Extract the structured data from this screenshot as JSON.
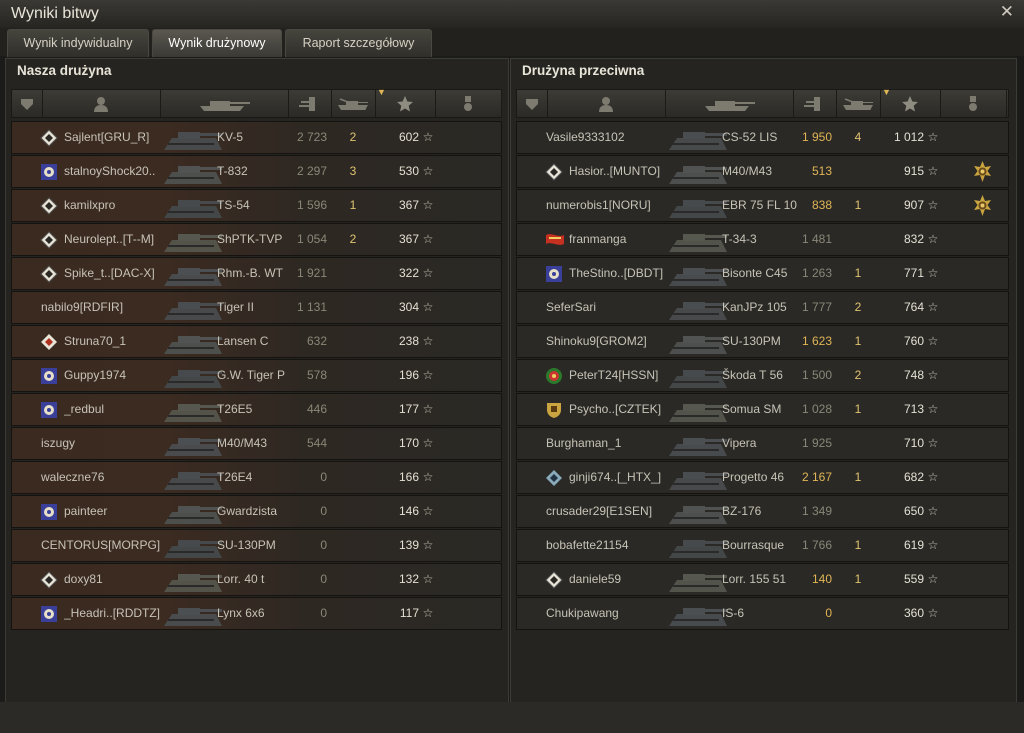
{
  "window": {
    "title": "Wyniki bitwy",
    "close_icon": "close-icon"
  },
  "tabs": [
    {
      "label": "Wynik indywidualny",
      "active": false
    },
    {
      "label": "Wynik drużynowy",
      "active": true
    },
    {
      "label": "Raport szczegółowy",
      "active": false
    }
  ],
  "colors": {
    "alive_row": "#3c2b21",
    "damage_highlight": "#e0b556",
    "kills": "#e0c370"
  },
  "our_team": {
    "title": "Nasza drużyna",
    "columns": [
      "squad-icon",
      "player-icon",
      "tank-icon",
      "damage-icon",
      "kills-icon",
      "xp-star-icon",
      "medal-icon"
    ],
    "players": [
      {
        "name": "Sajlent[GRU_R]",
        "vehicle": "KV-5",
        "damage": "2 723",
        "kills": "2",
        "xp": "602",
        "alive": true,
        "clan_icon": "diamond",
        "highlight_damage": false
      },
      {
        "name": "stalnoyShock20..",
        "vehicle": "T-832",
        "damage": "2 297",
        "kills": "3",
        "xp": "530",
        "alive": true,
        "clan_icon": "gear",
        "highlight_damage": false
      },
      {
        "name": "kamilxpro",
        "vehicle": "TS-54",
        "damage": "1 596",
        "kills": "1",
        "xp": "367",
        "alive": true,
        "clan_icon": "diamond",
        "highlight_damage": false
      },
      {
        "name": "Neurolept..[T--M]",
        "vehicle": "ShPTK-TVP",
        "damage": "1 054",
        "kills": "2",
        "xp": "367",
        "alive": true,
        "clan_icon": "diamond",
        "highlight_damage": false
      },
      {
        "name": "Spike_t..[DAC-X]",
        "vehicle": "Rhm.-B. WT",
        "damage": "1 921",
        "kills": "",
        "xp": "322",
        "alive": true,
        "clan_icon": "diamond",
        "highlight_damage": false
      },
      {
        "name": "nabilo9[RDFIR]",
        "vehicle": "Tiger II",
        "damage": "1 131",
        "kills": "",
        "xp": "304",
        "alive": true,
        "clan_icon": "",
        "highlight_damage": false
      },
      {
        "name": "Struna70_1",
        "vehicle": "Lansen C",
        "damage": "632",
        "kills": "",
        "xp": "238",
        "alive": true,
        "clan_icon": "diamond-red",
        "highlight_damage": false
      },
      {
        "name": "Guppy1974",
        "vehicle": "G.W. Tiger P",
        "damage": "578",
        "kills": "",
        "xp": "196",
        "alive": true,
        "clan_icon": "gear",
        "highlight_damage": false
      },
      {
        "name": "_redbul",
        "vehicle": "T26E5",
        "damage": "446",
        "kills": "",
        "xp": "177",
        "alive": true,
        "clan_icon": "gear",
        "highlight_damage": false
      },
      {
        "name": "iszugy",
        "vehicle": "M40/M43",
        "damage": "544",
        "kills": "",
        "xp": "170",
        "alive": true,
        "clan_icon": "",
        "highlight_damage": false
      },
      {
        "name": "waleczne76",
        "vehicle": "T26E4",
        "damage": "0",
        "kills": "",
        "xp": "166",
        "alive": true,
        "clan_icon": "",
        "highlight_damage": false
      },
      {
        "name": "painteer",
        "vehicle": "Gwardzista",
        "damage": "0",
        "kills": "",
        "xp": "146",
        "alive": true,
        "clan_icon": "gear",
        "highlight_damage": false
      },
      {
        "name": "CENTORUS[MORPG]",
        "vehicle": "SU-130PM",
        "damage": "0",
        "kills": "",
        "xp": "139",
        "alive": true,
        "clan_icon": "",
        "highlight_damage": false
      },
      {
        "name": "doxy81",
        "vehicle": "Lorr. 40 t",
        "damage": "0",
        "kills": "",
        "xp": "132",
        "alive": true,
        "clan_icon": "diamond",
        "highlight_damage": false
      },
      {
        "name": "_Headri..[RDDTZ]",
        "vehicle": "Lynx 6x6",
        "damage": "0",
        "kills": "",
        "xp": "117",
        "alive": true,
        "clan_icon": "gear",
        "highlight_damage": false
      }
    ]
  },
  "enemy_team": {
    "title": "Drużyna przeciwna",
    "players": [
      {
        "name": "Vasile9333102",
        "vehicle": "CS-52 LIS",
        "damage": "1 950",
        "kills": "4",
        "xp": "1 012",
        "clan_icon": "",
        "highlight_damage": true,
        "medal": false
      },
      {
        "name": "Hasior..[MUNTO]",
        "vehicle": "M40/M43",
        "damage": "513",
        "kills": "",
        "xp": "915",
        "clan_icon": "diamond",
        "highlight_damage": true,
        "medal": true
      },
      {
        "name": "numerobis1[NORU]",
        "vehicle": "EBR 75 FL 10",
        "damage": "838",
        "kills": "1",
        "xp": "907",
        "clan_icon": "",
        "highlight_damage": true,
        "medal": true
      },
      {
        "name": "franmanga",
        "vehicle": "T-34-3",
        "damage": "1 481",
        "kills": "",
        "xp": "832",
        "clan_icon": "flag",
        "highlight_damage": false,
        "medal": false
      },
      {
        "name": "TheStino..[DBDT]",
        "vehicle": "Bisonte C45",
        "damage": "1 263",
        "kills": "1",
        "xp": "771",
        "clan_icon": "gear",
        "highlight_damage": false,
        "medal": false
      },
      {
        "name": "SeferSari",
        "vehicle": "KanJPz 105",
        "damage": "1 777",
        "kills": "2",
        "xp": "764",
        "clan_icon": "",
        "highlight_damage": false,
        "medal": false
      },
      {
        "name": "Shinoku9[GROM2]",
        "vehicle": "SU-130PM",
        "damage": "1 623",
        "kills": "1",
        "xp": "760",
        "clan_icon": "",
        "highlight_damage": true,
        "medal": false
      },
      {
        "name": "PeterT24[HSSN]",
        "vehicle": "Škoda T 56",
        "damage": "1 500",
        "kills": "2",
        "xp": "748",
        "clan_icon": "wreath",
        "highlight_damage": false,
        "medal": false
      },
      {
        "name": "Psycho..[CZTEK]",
        "vehicle": "Somua SM",
        "damage": "1 028",
        "kills": "1",
        "xp": "713",
        "clan_icon": "shield",
        "highlight_damage": false,
        "medal": false
      },
      {
        "name": "Burghaman_1",
        "vehicle": "Vipera",
        "damage": "1 925",
        "kills": "",
        "xp": "710",
        "clan_icon": "",
        "highlight_damage": false,
        "medal": false
      },
      {
        "name": "ginji674..[_HTX_]",
        "vehicle": "Progetto 46",
        "damage": "2 167",
        "kills": "1",
        "xp": "682",
        "clan_icon": "diamond-blue",
        "highlight_damage": true,
        "medal": false
      },
      {
        "name": "crusader29[E1SEN]",
        "vehicle": "BZ-176",
        "damage": "1 349",
        "kills": "",
        "xp": "650",
        "clan_icon": "",
        "highlight_damage": false,
        "medal": false
      },
      {
        "name": "bobafette21154",
        "vehicle": "Bourrasque",
        "damage": "1 766",
        "kills": "1",
        "xp": "619",
        "clan_icon": "",
        "highlight_damage": false,
        "medal": false
      },
      {
        "name": "daniele59",
        "vehicle": "Lorr. 155 51",
        "damage": "140",
        "kills": "1",
        "xp": "559",
        "clan_icon": "diamond",
        "highlight_damage": true,
        "medal": false
      },
      {
        "name": "Chukipawang",
        "vehicle": "IS-6",
        "damage": "0",
        "kills": "",
        "xp": "360",
        "clan_icon": "",
        "highlight_damage": true,
        "medal": false
      }
    ]
  }
}
